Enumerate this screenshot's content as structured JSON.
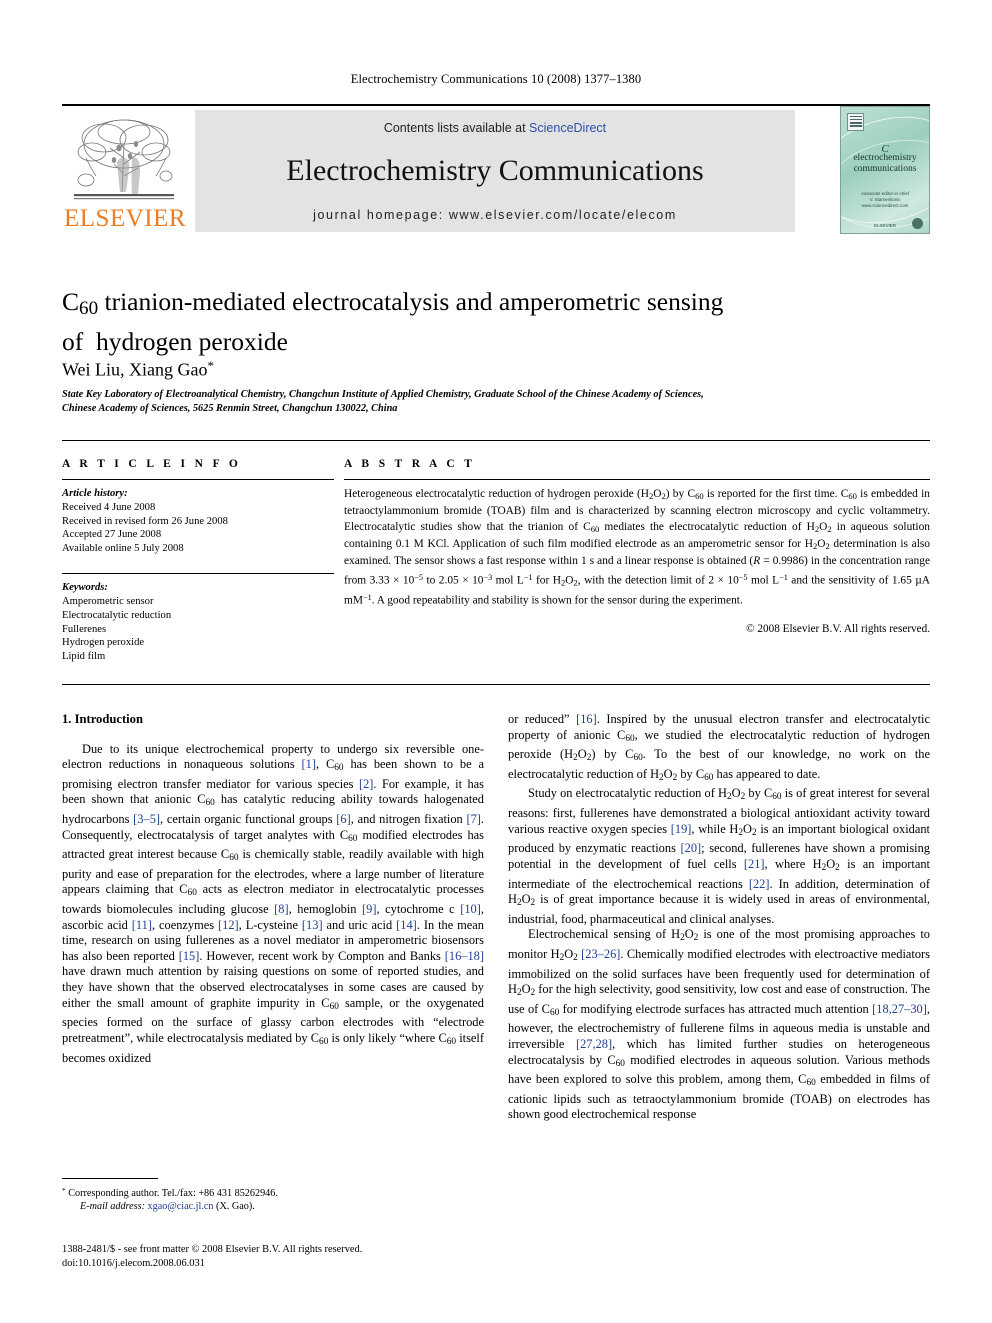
{
  "running_head": "Electrochemistry Communications 10 (2008) 1377–1380",
  "banner": {
    "publisher": "ELSEVIER",
    "contents_prefix": "Contents lists available at ",
    "contents_link": "ScienceDirect",
    "journal_title": "Electrochemistry Communications",
    "homepage": "journal homepage: www.elsevier.com/locate/elecom",
    "cover": {
      "mark": "C",
      "title_line1": "electrochemistry",
      "title_line2": "communications",
      "sub_line1": "Associate editor-in-chief",
      "sub_line2": "V. Stamenkovic",
      "sub_line3": "www.sciencedirect.com",
      "footer": "ELSEVIER"
    }
  },
  "article": {
    "title_line1": "C60 trianion-mediated electrocatalysis and amperometric sensing",
    "title_line2": "of  hydrogen peroxide",
    "authors": "Wei Liu, Xiang Gao",
    "author_marker": "*",
    "affiliation_line1": "State Key Laboratory of Electroanalytical Chemistry, Changchun Institute of Applied Chemistry, Graduate School of the Chinese Academy of Sciences,",
    "affiliation_line2": "Chinese Academy of Sciences, 5625 Renmin Street, Changchun 130022, China"
  },
  "article_info": {
    "heading": "A R T I C L E   I N F O",
    "history_label": "Article history:",
    "history": [
      "Received 4 June 2008",
      "Received in revised form 26 June 2008",
      "Accepted 27 June 2008",
      "Available online 5 July 2008"
    ],
    "keywords_label": "Keywords:",
    "keywords": [
      "Amperometric sensor",
      "Electrocatalytic reduction",
      "Fullerenes",
      "Hydrogen peroxide",
      "Lipid film"
    ]
  },
  "abstract": {
    "heading": "A B S T R A C T",
    "copyright": "© 2008 Elsevier B.V. All rights reserved."
  },
  "introduction": {
    "heading": "1. Introduction"
  },
  "footnote": {
    "corresponding": "Corresponding author. Tel./fax: +86 431 85262946.",
    "email_label": "E-mail address:",
    "email": "xgao@ciac.jl.cn",
    "email_owner": "(X. Gao)."
  },
  "imprint": {
    "line1": "1388-2481/$ - see front matter © 2008 Elsevier B.V. All rights reserved.",
    "line2": "doi:10.1016/j.elecom.2008.06.031"
  },
  "colors": {
    "link": "#2b4ea8",
    "reference": "#1f3f8f",
    "elsevier_orange": "#ED7D22",
    "banner_gray": "#e3e3e3"
  }
}
